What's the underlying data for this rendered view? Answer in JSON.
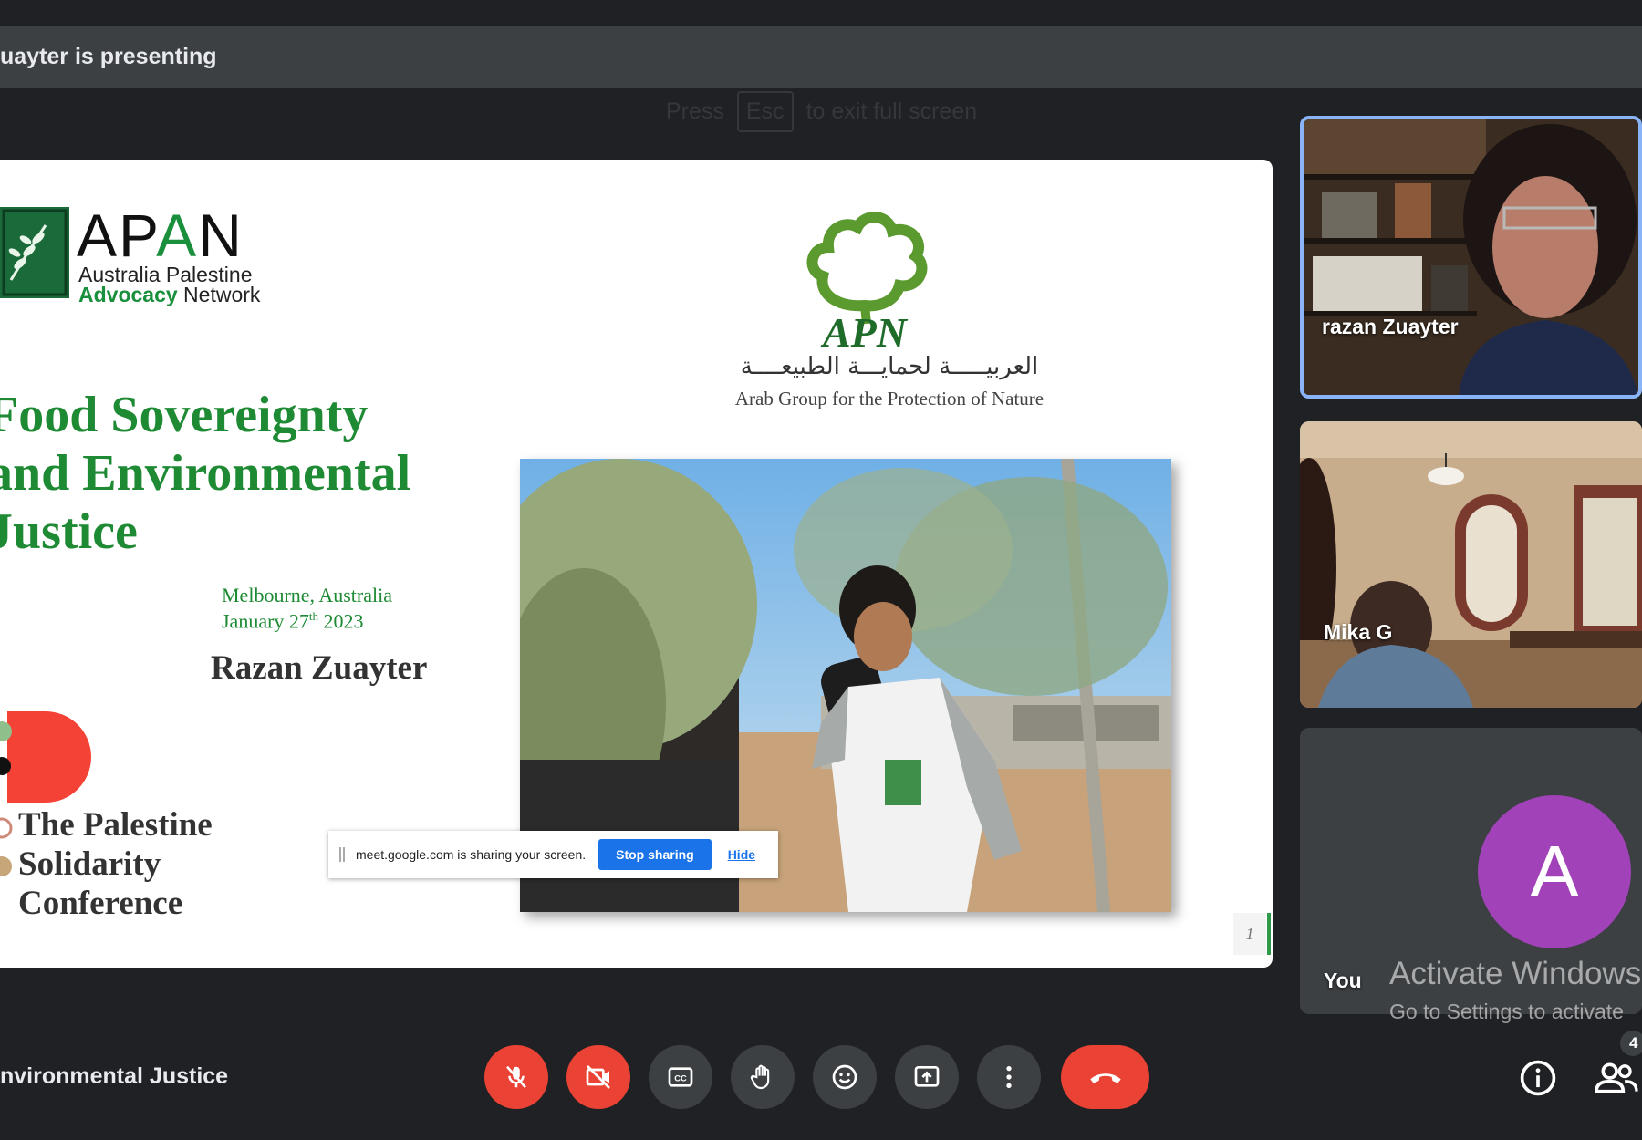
{
  "top_bar": {
    "presenting_text": "uayter is presenting"
  },
  "fullscreen_hint": {
    "press": "Press",
    "key": "Esc",
    "rest": "to exit full screen"
  },
  "slide": {
    "apan": {
      "title_prefix": "AP",
      "title_green": "A",
      "title_suffix": "N",
      "line1": "Australia Palestine",
      "line2_green": "Advocacy",
      "line2_rest": " Network"
    },
    "apn": {
      "logo_text": "APN",
      "arabic": "العربيـــــة لحمايـــة الطبيعــــة",
      "english": "Arab Group for the Protection of Nature"
    },
    "title_lines": [
      "Food Sovereignty",
      "and Environmental",
      "Justice"
    ],
    "place": "Melbourne, Australia",
    "date_prefix": "January 27",
    "date_sup": "th",
    "date_suffix": " 2023",
    "presenter": "Razan Zuayter",
    "conference_lines": [
      "The Palestine",
      "Solidarity",
      "Conference"
    ],
    "page_number": "1"
  },
  "share_banner": {
    "text": "meet.google.com is sharing your screen.",
    "stop_label": "Stop sharing",
    "hide_label": "Hide"
  },
  "participants": [
    {
      "name": "razan Zuayter"
    },
    {
      "name": "Mika G"
    },
    {
      "name": "You",
      "avatar_letter": "A",
      "avatar_color": "#a142b8"
    }
  ],
  "watermark": {
    "title": "Activate Windows",
    "subtitle": "Go to Settings to activate"
  },
  "bottom": {
    "meeting_title": "nvironmental Justice",
    "controls": [
      {
        "icon": "mic-off-icon",
        "color": "#ea4335"
      },
      {
        "icon": "camera-off-icon",
        "color": "#ea4335"
      },
      {
        "icon": "captions-icon",
        "color": "#3c4043"
      },
      {
        "icon": "raise-hand-icon",
        "color": "#3c4043"
      },
      {
        "icon": "emoji-icon",
        "color": "#3c4043"
      },
      {
        "icon": "present-screen-icon",
        "color": "#3c4043"
      },
      {
        "icon": "more-options-icon",
        "color": "#3c4043"
      },
      {
        "icon": "end-call-icon",
        "color": "#ea4335"
      }
    ],
    "people_count": "4"
  }
}
